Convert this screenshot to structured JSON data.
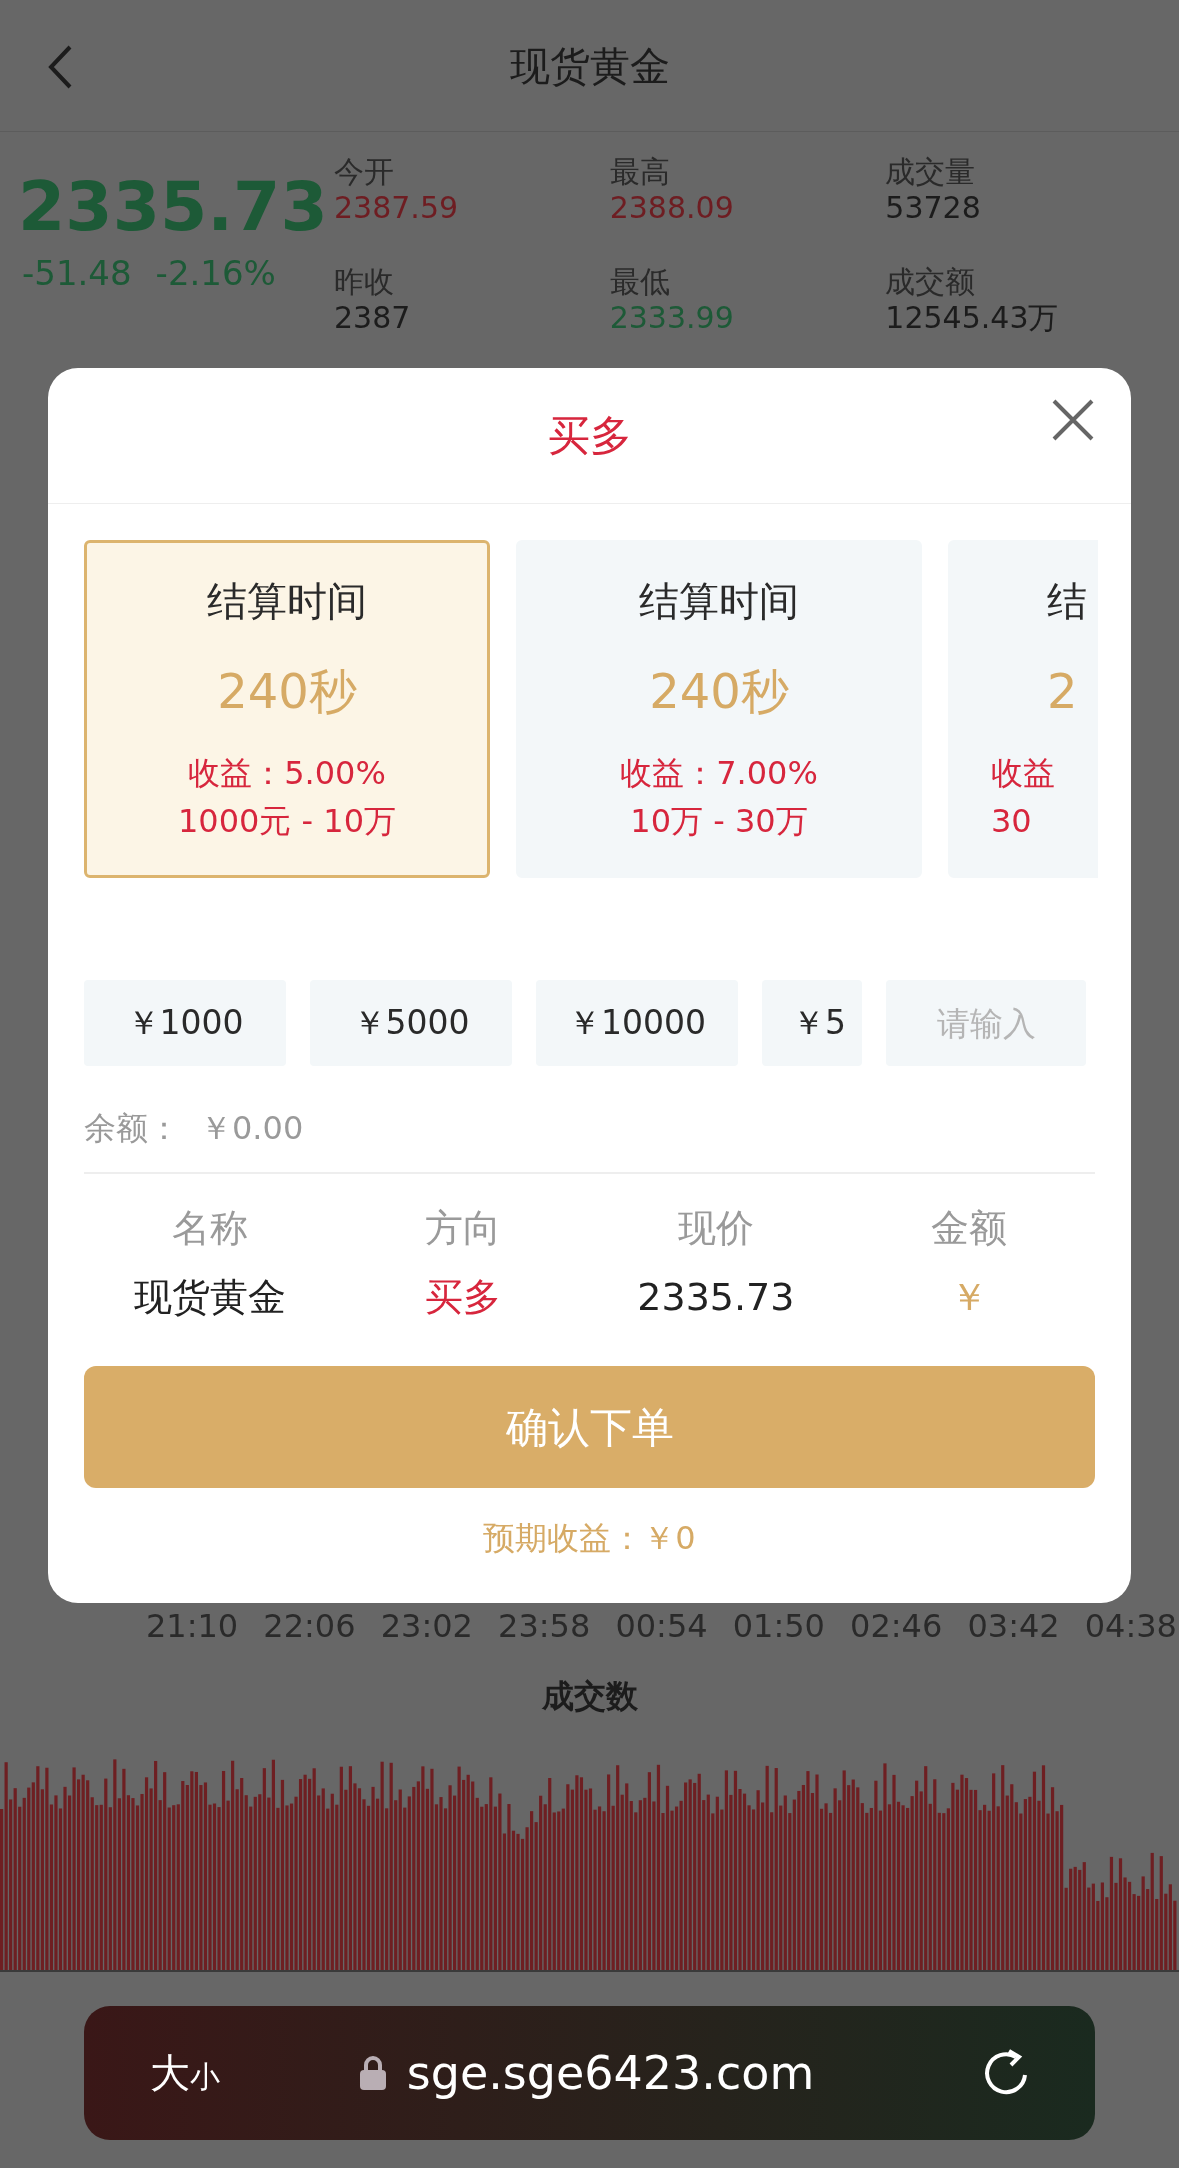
{
  "header": {
    "title": "现货黄金"
  },
  "quote": {
    "price": "2335.73",
    "change": "-51.48",
    "change_pct": "-2.16%",
    "stats": [
      {
        "label": "今开",
        "value": "2387.59",
        "color": "#6e1d22"
      },
      {
        "label": "最高",
        "value": "2388.09",
        "color": "#6e1d22"
      },
      {
        "label": "成交量",
        "value": "53728",
        "color": "#1c1c1c"
      },
      {
        "label": "昨收",
        "value": "2387",
        "color": "#1c1c1c"
      },
      {
        "label": "最低",
        "value": "2333.99",
        "color": "#1d5a37"
      },
      {
        "label": "成交额",
        "value": "12545.43万",
        "color": "#1c1c1c"
      }
    ]
  },
  "time_axis": [
    "21:10",
    "22:06",
    "23:02",
    "23:58",
    "00:54",
    "01:50",
    "02:46",
    "03:42",
    "04:38"
  ],
  "volume_title": "成交数",
  "modal": {
    "title": "买多",
    "plans": [
      {
        "title": "结算时间",
        "duration": "240秒",
        "yield": "收益：5.00%",
        "range": "1000元 - 10万",
        "selected": true
      },
      {
        "title": "结算时间",
        "duration": "240秒",
        "yield": "收益：7.00%",
        "range": "10万 - 30万",
        "selected": false
      },
      {
        "title": "结",
        "duration": "2",
        "yield": "收益",
        "range": "30",
        "selected": false
      }
    ],
    "amounts": [
      "￥1000",
      "￥5000",
      "￥10000",
      "￥5"
    ],
    "amount_placeholder": "请输入",
    "balance_label": "余额：",
    "balance": "￥0.00",
    "columns": [
      "名称",
      "方向",
      "现价",
      "金额"
    ],
    "row": [
      "现货黄金",
      "买多",
      "2335.73",
      "￥"
    ],
    "confirm": "确认下单",
    "expected": "预期收益：￥0"
  },
  "browser": {
    "text_size": "大",
    "text_size_small": "小",
    "url": "sge.sge6423.com"
  }
}
